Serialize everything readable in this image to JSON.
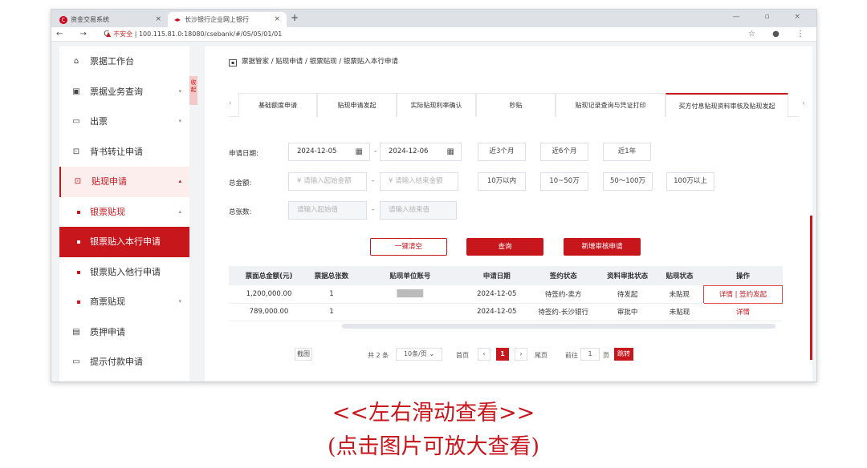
{
  "browser": {
    "tab1": {
      "title": "资金交易系统",
      "favicon": "C",
      "close": "×"
    },
    "tab2": {
      "title": "长沙银行企业网上银行",
      "favicon": "◂▸",
      "close": "×"
    },
    "new_tab": "+",
    "window_controls": "— ▫ ×",
    "nav_buttons": "← → C",
    "security": "不安全",
    "url": "100.115.81.0:18080/csebank/#/05/05/01/01",
    "right_icons": "☆ ● ⋮"
  },
  "sidebar": {
    "collapse_label": "收起",
    "items": [
      {
        "label": "票据工作台",
        "icon": "⌂"
      },
      {
        "label": "票据业务查询",
        "icon": "▣",
        "arrow": "▾"
      },
      {
        "label": "出票",
        "icon": "▭",
        "arrow": "▾"
      },
      {
        "label": "背书转让申请",
        "icon": "⊡"
      },
      {
        "label": "贴现申请",
        "icon": "⊡",
        "arrow": "▴"
      },
      {
        "label": "银票贴现",
        "arrow": "▴"
      },
      {
        "label": "银票贴入本行申请"
      },
      {
        "label": "银票贴入他行申请"
      },
      {
        "label": "商票贴现",
        "arrow": "▾"
      },
      {
        "label": "质押申请",
        "icon": "▤"
      },
      {
        "label": "提示付款申请",
        "icon": "▭"
      }
    ]
  },
  "breadcrumb": {
    "home_icon": "▪",
    "items": [
      "票据管家",
      "贴现申请",
      "银票贴现",
      "银票贴入本行申请"
    ],
    "sep": "/"
  },
  "tabs": {
    "scroll_left": "‹",
    "scroll_right": "›",
    "items": [
      "基础额度申请",
      "贴现申请发起",
      "实际贴现利率确认",
      "秒贴",
      "贴现记录查询与凭证打印",
      "买方付息贴现资料审核及贴现发起"
    ]
  },
  "filters": {
    "date_label": "申请日期:",
    "date_start": "2024-12-05",
    "date_end": "2024-12-06",
    "date_sep": "-",
    "date_quick": [
      "近3个月",
      "近6个月",
      "近1年"
    ],
    "amount_label": "总金额:",
    "amount_min_placeholder": "¥  请输入起始金额",
    "amount_max_placeholder": "¥  请输入结束金额",
    "amount_quick": [
      "10万以内",
      "10~50万",
      "50～100万",
      "100万以上"
    ],
    "count_label": "总张数:",
    "count_min_placeholder": "请输入起始值",
    "count_max_placeholder": "请输入结束值",
    "calendar_icon": "▦"
  },
  "actions": {
    "clear": "一键清空",
    "query": "查询",
    "new": "新增审核申请"
  },
  "table": {
    "headers": [
      "票面总金额(元)",
      "票据总张数",
      "贴现单位账号",
      "申请日期",
      "签约状态",
      "资料审批状态",
      "贴现状态",
      "操作"
    ],
    "rows": [
      {
        "amount": "1,200,000.00",
        "count": "1",
        "account": "█████",
        "date": "2024-12-05",
        "sign": "待签约-卖方",
        "review": "待发起",
        "status": "未贴现",
        "ops": "详情 | 签约发起"
      },
      {
        "amount": "789,000.00",
        "count": "1",
        "account": "",
        "date": "2024-12-05",
        "sign": "待签约-长沙银行",
        "review": "审批中",
        "status": "未贴现",
        "ops": "详情"
      }
    ]
  },
  "pager": {
    "screenshot_btn": "截图",
    "total": "共 2 条",
    "page_size": "10条/页 ⌄",
    "first": "首页",
    "prev": "‹",
    "current": "1",
    "next": "›",
    "last": "尾页",
    "goto_label": "前往",
    "goto_value": "1",
    "page_unit": "页",
    "jump": "跳转"
  },
  "captions": {
    "line1": "<<左右滑动查看>>",
    "line2": "(点击图片可放大查看)"
  },
  "colors": {
    "brand": "#c8161d",
    "sidebar_active_bg": "#fdeeee"
  }
}
